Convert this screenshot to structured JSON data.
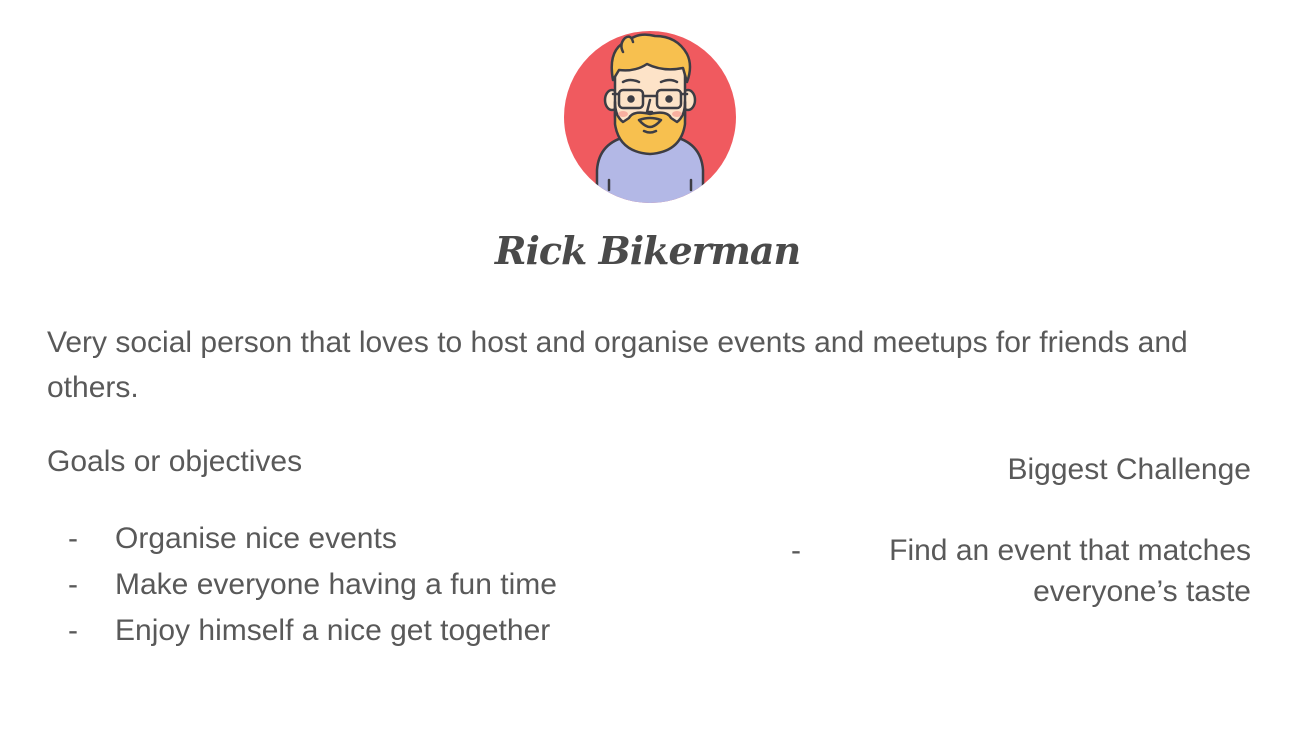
{
  "persona": {
    "name": "Rick Bikerman",
    "description": "Very social person that loves to host and organise events and meetups for friends and others.",
    "avatar_icon": "bearded-man-avatar-icon",
    "colors": {
      "avatar_background": "#f05a5f",
      "hair": "#f7c04f",
      "shirt": "#b3b8e6",
      "skin": "#fde3c8",
      "text": "#595959"
    }
  },
  "goals": {
    "title": "Goals or objectives",
    "items": [
      {
        "marker": "-",
        "text": "Organise nice events"
      },
      {
        "marker": "-",
        "text": "Make everyone having a fun time"
      },
      {
        "marker": "-",
        "text": "Enjoy himself a nice get together"
      }
    ]
  },
  "challenge": {
    "title": "Biggest Challenge",
    "items": [
      {
        "marker": "-",
        "text": "Find an event that matches everyone’s taste"
      }
    ]
  }
}
